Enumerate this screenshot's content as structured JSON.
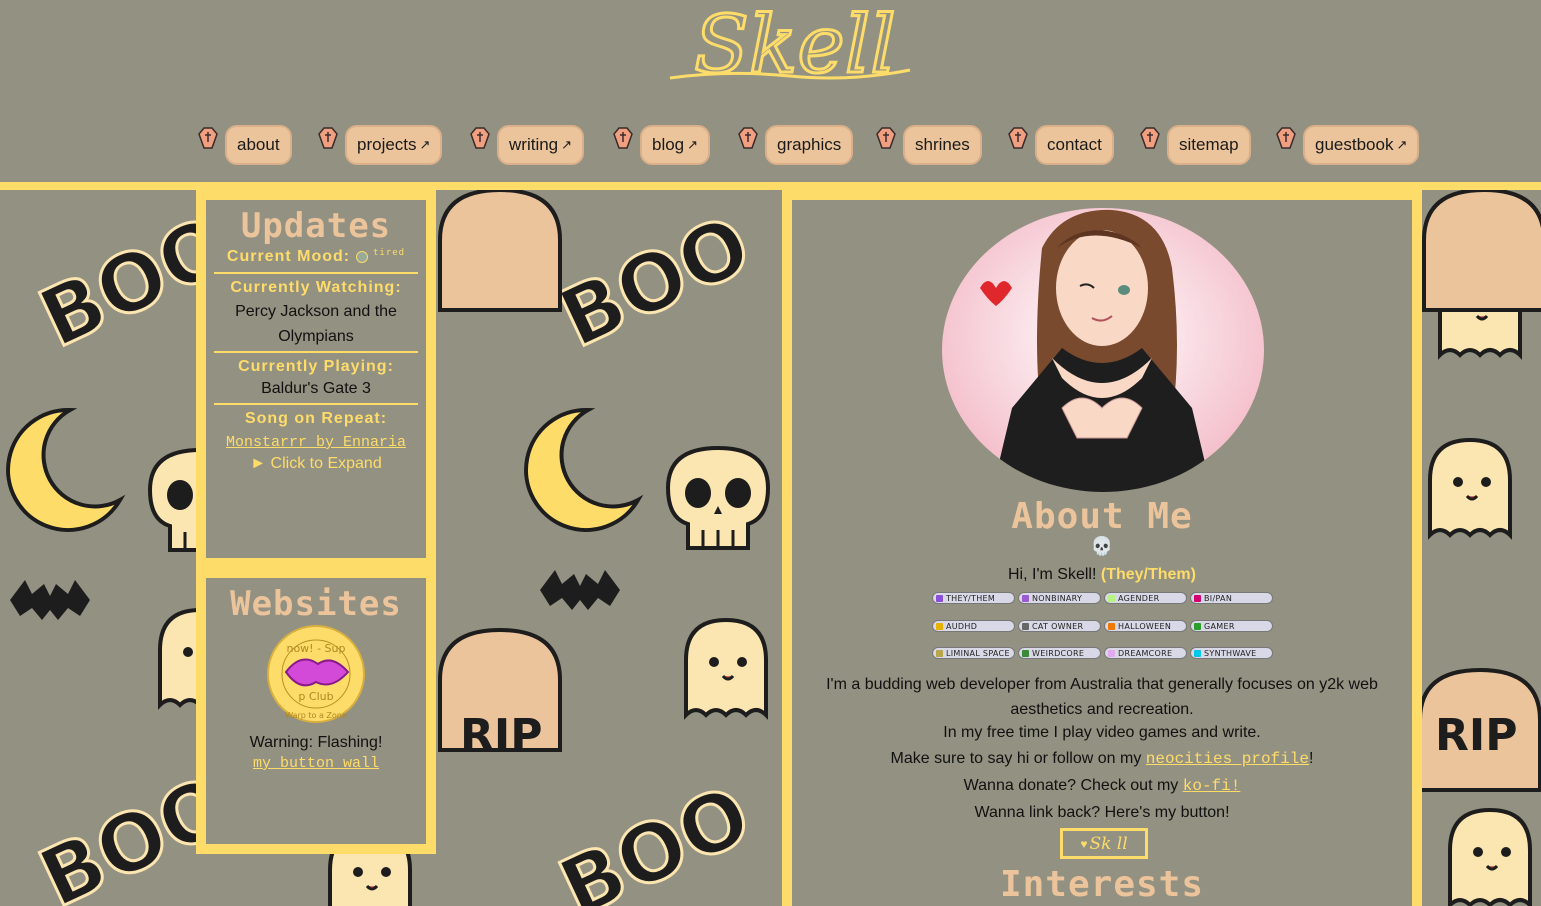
{
  "site": {
    "logo_text": "Skell"
  },
  "nav": [
    {
      "label": "about",
      "external": false
    },
    {
      "label": "projects",
      "external": true
    },
    {
      "label": "writing",
      "external": true
    },
    {
      "label": "blog",
      "external": true
    },
    {
      "label": "graphics",
      "external": false
    },
    {
      "label": "shrines",
      "external": false
    },
    {
      "label": "contact",
      "external": false
    },
    {
      "label": "sitemap",
      "external": false
    },
    {
      "label": "guestbook",
      "external": true
    }
  ],
  "nav_ext_glyph": "↗",
  "pattern_words": {
    "boo": "BOO",
    "rip": "RIP"
  },
  "updates": {
    "title": "Updates",
    "mood_label": "Current Mood:",
    "mood_value": "tired",
    "watching_label": "Currently Watching:",
    "watching_value": "Percy Jackson and the Olympians",
    "playing_label": "Currently Playing:",
    "playing_value": "Baldur's Gate 3",
    "song_label": "Song on Repeat:",
    "song_value": "Monstarrr by Ennaria",
    "expand_label": "► Click to Expand"
  },
  "websites": {
    "title": "Websites",
    "button_text_top": "now! - Sup",
    "button_text_bottom": "p Club",
    "button_text_ring": "Warp to a Zone",
    "warning": "Warning: Flashing!",
    "link": "my button wall"
  },
  "about": {
    "heading": "About Me",
    "skull": "💀",
    "greeting": "Hi, I'm Skell!",
    "pronouns": "(They/Them)",
    "badges": [
      {
        "label": "THEY/THEM",
        "color": "#8a4fd8"
      },
      {
        "label": "NONBINARY",
        "color": "#9c59d1"
      },
      {
        "label": "AGENDER",
        "color": "#b8f483"
      },
      {
        "label": "BI/PAN",
        "color": "#d60270"
      },
      {
        "label": "AUDHD",
        "color": "#e8b000"
      },
      {
        "label": "CAT OWNER",
        "color": "#666666"
      },
      {
        "label": "HALLOWEEN",
        "color": "#f07a00"
      },
      {
        "label": "GAMER",
        "color": "#2aa02a"
      },
      {
        "label": "LIMINAL SPACE",
        "color": "#b7a64a"
      },
      {
        "label": "WEIRDCORE",
        "color": "#3a8a3a"
      },
      {
        "label": "DREAMCORE",
        "color": "#e3a8f0"
      },
      {
        "label": "SYNTHWAVE",
        "color": "#00c8e8"
      }
    ],
    "bio_1": "I'm a budding web developer from Australia that generally focuses on y2k web aesthetics and recreation.",
    "bio_2": "In my free time I play video games and write.",
    "neocities_prefix": "Make sure to say hi or follow on my ",
    "neocities_link": "neocities profile",
    "neocities_suffix": "!",
    "donate_prefix": "Wanna donate? Check out my ",
    "donate_link": "ko-fi!",
    "linkback": "Wanna link back? Here's my button!",
    "button_text": "Sk ll",
    "interests_heading": "Interests"
  },
  "colors": {
    "bg": "#939181",
    "yellow": "#fedc6a",
    "peach": "#ecc49c"
  }
}
